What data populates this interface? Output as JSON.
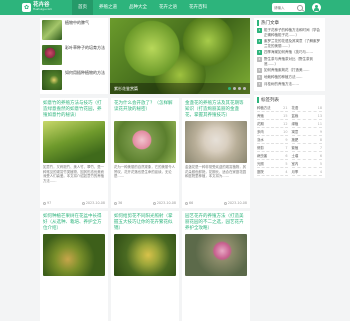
{
  "site": {
    "name": "花卉谷",
    "subtitle": "Huahuigu.com"
  },
  "nav": [
    {
      "label": "首页",
      "active": true
    },
    {
      "label": "养殖之道",
      "active": false
    },
    {
      "label": "品种大全",
      "active": false
    },
    {
      "label": "花卉之语",
      "active": false
    },
    {
      "label": "花卉百科",
      "active": false
    }
  ],
  "search": {
    "placeholder": "请输入"
  },
  "top_list": [
    {
      "title": "植物中的脾气"
    },
    {
      "title": "彩叶草种子的培育方法"
    },
    {
      "title": "如何用插种植物的方法"
    }
  ],
  "slider": {
    "caption": "紫杉花鉴赏篇",
    "slides": 4,
    "active": 1
  },
  "cards": [
    {
      "title": "如意竹的养殖方法与技巧（打造绿意盎然的如意竹花园，养殖如意竹的秘诀）",
      "text": "如意竹，又称斑竹、美人竹、翠竹、是一种常见的观赏竹类植物，因其形态优美而深受人们喜爱。本文将介绍如意竹的养殖方法……",
      "views": "97",
      "date": "2023-10-08"
    },
    {
      "title": "花为什么会开放了？（怎样解读花开放的秘密）",
      "text": "花为一种美丽的自然现象，它的美丽令人赞叹，花开花落也是生命的延续，无论是……",
      "views": "36",
      "date": "2023-10-08"
    },
    {
      "title": "金盏花的养殖方法及其花期等知识（打造绚丽美丽的金盏花，掌握其养殖技巧）",
      "text": "金盏花是一种非常受欢迎的观赏植物，其花朵颜色鲜艳，花期长，适合在家庭花园和庭院里种植，本文将为……",
      "views": "66",
      "date": "2023-10-08"
    },
    {
      "title": "如何种植芒果树在花盆中长得好（从选种、栽培、养护全方位介绍）",
      "text": "",
      "views": "",
      "date": ""
    },
    {
      "title": "如何给剪花不同阳光照射（掌握五大技巧让你的花卉繁花似锦）",
      "text": "",
      "views": "",
      "date": ""
    },
    {
      "title": "园艺花卉的养殖方法（打造美丽花园的不二之选，园艺花卉养护全攻略）",
      "text": "",
      "views": "",
      "date": ""
    }
  ],
  "sidebar": {
    "title": "热门文章",
    "articles": [
      {
        "num": "1",
        "title": "栀子花种子的种植方法和时间（学会正确种植栀子花……）"
      },
      {
        "num": "2",
        "title": "紫罗兰花的花语及其寓意（了解紫罗兰花的美丽……）"
      },
      {
        "num": "3",
        "title": "四季海棠如何养殖（技巧与……"
      },
      {
        "num": "4",
        "title": "野生茶与养殖茶对比（野生茶到底……）"
      },
      {
        "num": "5",
        "title": "如何养殖紫荆花（打造美……"
      },
      {
        "num": "6",
        "title": "地栽种植的种植方法……"
      },
      {
        "num": "7",
        "title": "月桂树的养殖方法……"
      }
    ],
    "tags_title": "标签列表",
    "tags": [
      {
        "name": "种植方法",
        "count": "21"
      },
      {
        "name": "花语",
        "count": "18"
      },
      {
        "name": "养殖",
        "count": "15"
      },
      {
        "name": "盆栽",
        "count": "13"
      },
      {
        "name": "花期",
        "count": "12"
      },
      {
        "name": "绿植",
        "count": "11"
      },
      {
        "name": "多肉",
        "count": "10"
      },
      {
        "name": "寓意",
        "count": "9"
      },
      {
        "name": "浇水",
        "count": "9"
      },
      {
        "name": "施肥",
        "count": "8"
      },
      {
        "name": "修剪",
        "count": "7"
      },
      {
        "name": "繁殖",
        "count": "7"
      },
      {
        "name": "病虫害",
        "count": "6"
      },
      {
        "name": "土壤",
        "count": "6"
      },
      {
        "name": "光照",
        "count": "5"
      },
      {
        "name": "室内",
        "count": "5"
      },
      {
        "name": "庭院",
        "count": "4"
      },
      {
        "name": "月季",
        "count": "4"
      }
    ]
  },
  "colors": {
    "brand": "#2db47c"
  }
}
